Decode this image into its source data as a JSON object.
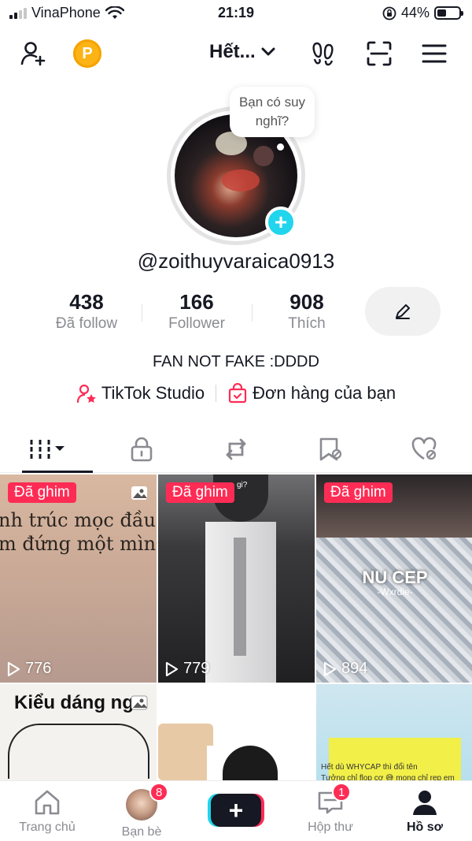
{
  "status_bar": {
    "carrier": "VinaPhone",
    "time": "21:19",
    "battery_percent": "44%",
    "battery_level": 0.44
  },
  "top_nav": {
    "account_name": "Hết...",
    "icons": [
      "add-friend-icon",
      "coin-icon",
      "chevron-down-icon",
      "footprints-icon",
      "qr-scan-icon",
      "menu-icon"
    ],
    "coin_label": "P"
  },
  "profile": {
    "thought_bubble": "Bạn có suy nghĩ?",
    "username": "@zoithuyvaraica0913",
    "stats": [
      {
        "value": "438",
        "label": "Đã follow"
      },
      {
        "value": "166",
        "label": "Follower"
      },
      {
        "value": "908",
        "label": "Thích"
      }
    ],
    "bio": "FAN NOT FAKE :DDDD",
    "links": [
      {
        "label": "TikTok Studio",
        "icon": "studio-icon"
      },
      {
        "label": "Đơn hàng của bạn",
        "icon": "shopping-bag-icon"
      }
    ]
  },
  "tabs": [
    "videos-grid",
    "private",
    "reposts",
    "favorites",
    "liked"
  ],
  "videos": [
    {
      "pinned_label": "Đã ghim",
      "views": "776",
      "overlay_lines": [
        "nh trúc mọc đầu đi",
        "m đứng một mình c"
      ]
    },
    {
      "pinned_label": "Đã ghim",
      "views": "779",
      "overlay_lines": [
        "gi?"
      ]
    },
    {
      "pinned_label": "Đã ghim",
      "views": "894",
      "overlay_lines": [
        "NU CEP",
        "-Wxrdie-"
      ]
    },
    {
      "overlay_lines": [
        "Kiểu dáng ngư"
      ]
    },
    {
      "overlay_lines": []
    },
    {
      "overlay_lines": [
        "Hết dù WHYCAP thì đổi tên",
        "Tưởng chỉ flop cơ 😅 mong chỉ rep em"
      ]
    }
  ],
  "bottom_nav": {
    "items": [
      {
        "label": "Trang chủ",
        "icon": "home-icon"
      },
      {
        "label": "Bạn bè",
        "badge": "8"
      },
      {
        "label": "",
        "icon": "plus-icon"
      },
      {
        "label": "Hộp thư",
        "badge": "1",
        "icon": "inbox-icon"
      },
      {
        "label": "Hồ sơ",
        "icon": "profile-icon"
      }
    ]
  }
}
